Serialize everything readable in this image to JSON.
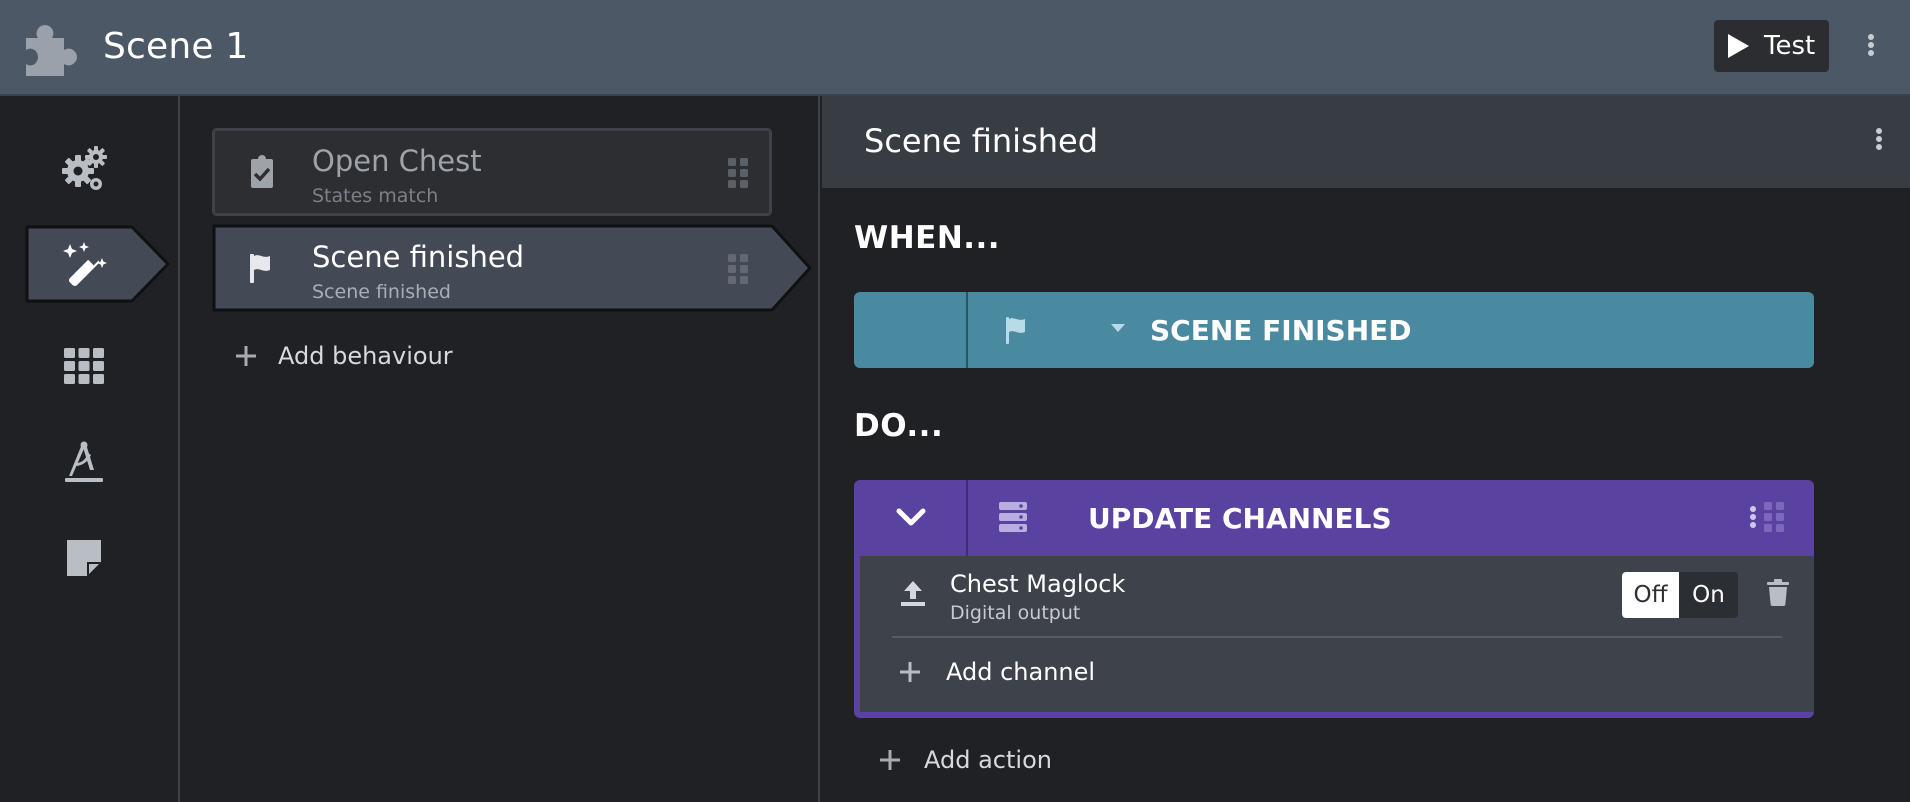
{
  "header": {
    "logo_icon": "puzzle-piece-icon",
    "title": "Scene 1",
    "test_label": "Test",
    "colors": {
      "bar": "#4d5866",
      "button": "#2b2d31"
    }
  },
  "rail": {
    "items": [
      {
        "icon": "gears-icon",
        "active": false
      },
      {
        "icon": "magic-wand-icon",
        "active": true
      },
      {
        "icon": "grid-icon",
        "active": false
      },
      {
        "icon": "drafting-compass-icon",
        "active": false
      },
      {
        "icon": "sticky-note-icon",
        "active": false
      }
    ]
  },
  "behaviours": {
    "items": [
      {
        "name": "Open Chest",
        "subtitle": "States match",
        "icon": "clipboard-check-icon",
        "selected": false
      },
      {
        "name": "Scene finished",
        "subtitle": "Scene finished",
        "icon": "flag-icon",
        "selected": true
      }
    ],
    "add_label": "Add behaviour"
  },
  "editor": {
    "title": "Scene finished",
    "when_label": "WHEN...",
    "do_label": "DO...",
    "trigger": {
      "label": "SCENE FINISHED",
      "icon": "flag-icon",
      "color": "#4a8aa1"
    },
    "action": {
      "label": "UPDATE CHANNELS",
      "icon": "server-icon",
      "color": "#5a42a0",
      "channels": [
        {
          "name": "Chest Maglock",
          "type": "Digital output",
          "icon": "upload-icon",
          "off_label": "Off",
          "on_label": "On",
          "value": "Off"
        }
      ],
      "add_channel_label": "Add channel"
    },
    "add_action_label": "Add action"
  }
}
